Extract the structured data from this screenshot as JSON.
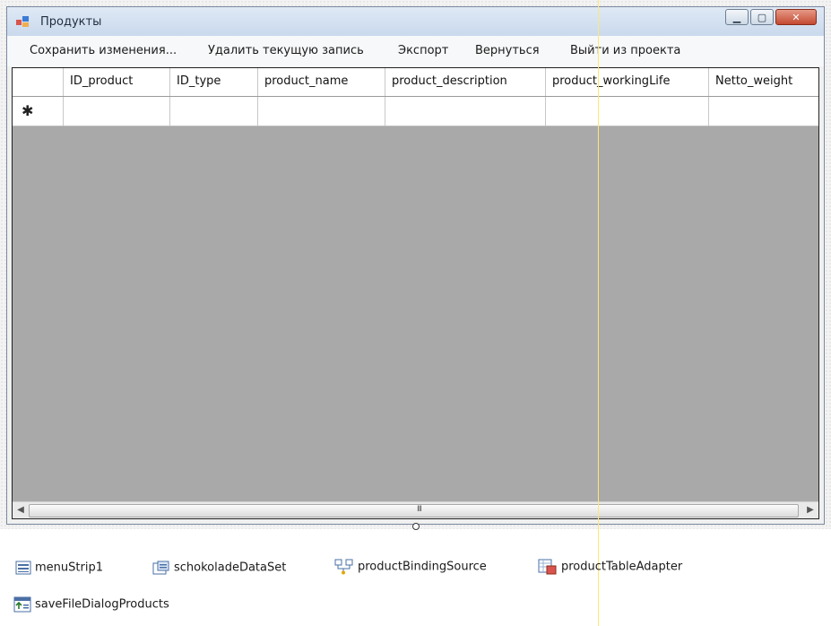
{
  "window": {
    "title": "Продукты"
  },
  "menu": {
    "items": [
      "Сохранить изменения...",
      "Удалить текущую запись",
      "Экспорт",
      "Вернуться",
      "Выйти из проекта"
    ]
  },
  "grid": {
    "columns": [
      "ID_product",
      "ID_type",
      "product_name",
      "product_description",
      "product_workingLife",
      "Netto_weight"
    ],
    "new_row_marker": "✱",
    "scroll_grip": "III"
  },
  "tray": {
    "items": [
      "menuStrip1",
      "schokoladeDataSet",
      "productBindingSource",
      "productTableAdapter",
      "saveFileDialogProducts"
    ]
  }
}
